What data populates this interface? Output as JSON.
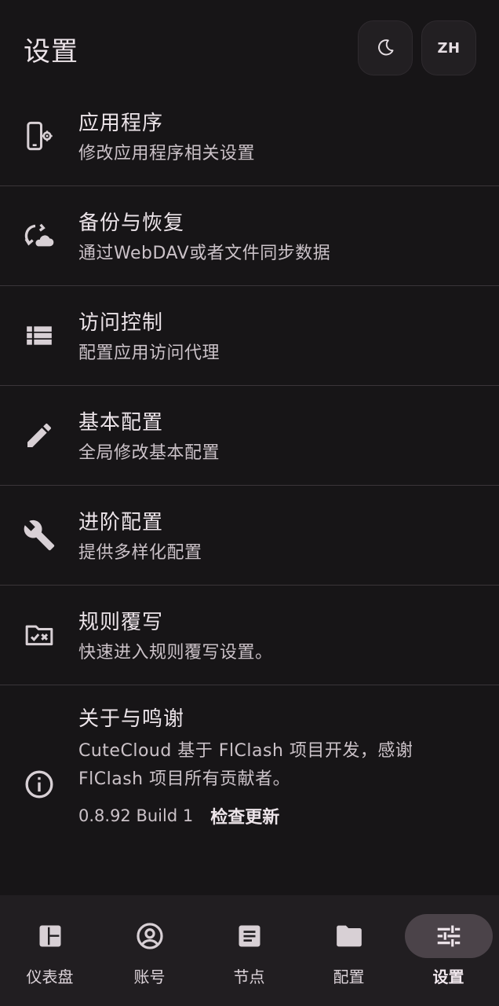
{
  "header": {
    "title": "设置",
    "theme_icon": "moon-icon",
    "lang_label": "ZH"
  },
  "settings": [
    {
      "title": "应用程序",
      "subtitle": "修改应用程序相关设置",
      "icon": "phone-settings-icon"
    },
    {
      "title": "备份与恢复",
      "subtitle": "通过WebDAV或者文件同步数据",
      "icon": "cloud-sync-icon"
    },
    {
      "title": "访问控制",
      "subtitle": "配置应用访问代理",
      "icon": "view-list-icon"
    },
    {
      "title": "基本配置",
      "subtitle": "全局修改基本配置",
      "icon": "pencil-icon"
    },
    {
      "title": "进阶配置",
      "subtitle": "提供多样化配置",
      "icon": "wrench-icon"
    },
    {
      "title": "规则覆写",
      "subtitle": "快速进入规则覆写设置。",
      "icon": "folder-check-icon"
    }
  ],
  "about": {
    "title": "关于与鸣谢",
    "subtitle": "CuteCloud 基于 FlClash 项目开发，感谢 FlClash 项目所有贡献者。",
    "version": "0.8.92 Build 1",
    "check_update": "检查更新",
    "icon": "info-icon"
  },
  "nav": [
    {
      "label": "仪表盘",
      "icon": "dashboard-icon",
      "active": false
    },
    {
      "label": "账号",
      "icon": "account-icon",
      "active": false
    },
    {
      "label": "节点",
      "icon": "article-icon",
      "active": false
    },
    {
      "label": "配置",
      "icon": "folder-icon",
      "active": false
    },
    {
      "label": "设置",
      "icon": "tune-icon",
      "active": true
    }
  ],
  "colors": {
    "background": "#171517",
    "text": "#ece4e9",
    "nav_background": "#211e21",
    "nav_active_pill": "#4b4349"
  }
}
